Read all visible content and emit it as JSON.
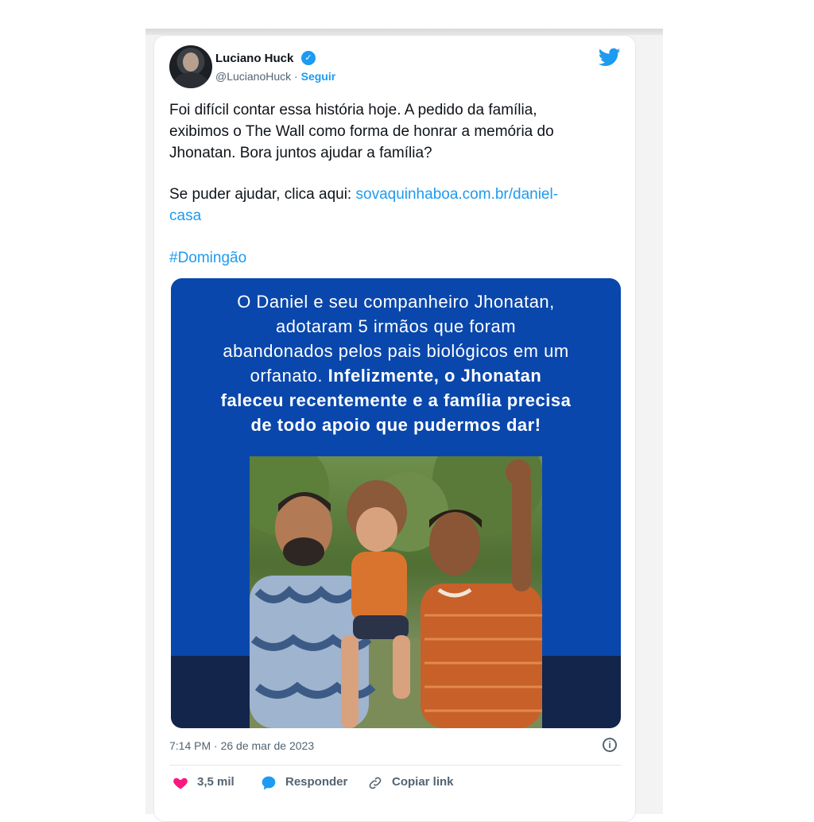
{
  "tweet": {
    "author_name": "Luciano Huck",
    "handle": "@LucianoHuck",
    "separator": "·",
    "follow_label": "Seguir",
    "line1": "Foi difícil contar essa história hoje. A pedido da família,",
    "line2": "exibimos o The Wall como forma de honrar a memória do",
    "line3": "Jhonatan. Bora juntos ajudar a família?",
    "help_text": "Se puder ajudar, clica aqui: ",
    "link_part1": "sovaquinhaboa.com.br/daniel-",
    "link_part2": "casa",
    "hashtag": "#Domingão",
    "timestamp": "7:14 PM · 26 de mar de 2023"
  },
  "media": {
    "line1": "O Daniel e seu companheiro Jhonatan,",
    "line2": "adotaram 5 irmãos que foram",
    "line3": "abandonados pelos pais biológicos em um",
    "line4": "orfanato. ",
    "bold1": "Infelizmente, o Jhonatan",
    "bold2": "faleceu recentemente e a família precisa",
    "bold3": "de todo apoio que pudermos dar!"
  },
  "actions": {
    "likes": "3,5 mil",
    "reply": "Responder",
    "copy": "Copiar link"
  },
  "colors": {
    "accent": "#1d9bf0",
    "like": "#f91880",
    "media_bg": "#0a47ac"
  },
  "icons": [
    "verified-badge-icon",
    "twitter-bird-icon",
    "info-icon",
    "heart-icon",
    "reply-icon",
    "link-icon"
  ]
}
